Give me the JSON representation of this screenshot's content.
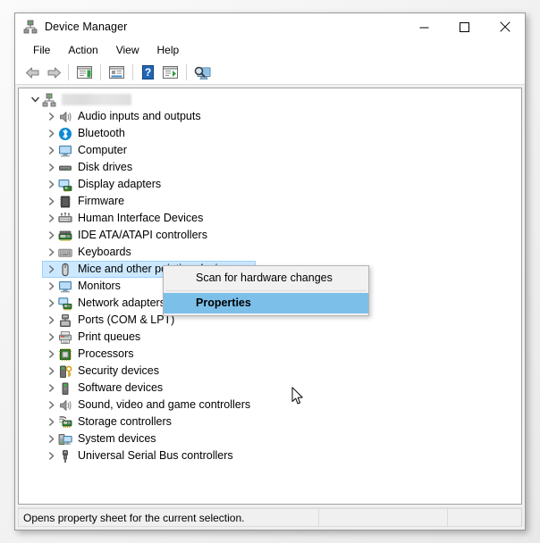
{
  "window": {
    "title": "Device Manager",
    "icon": "device-manager-icon",
    "controls": {
      "minimize": "—",
      "maximize": "□",
      "close": "✕"
    }
  },
  "menubar": {
    "items": [
      {
        "label": "File"
      },
      {
        "label": "Action"
      },
      {
        "label": "View"
      },
      {
        "label": "Help"
      }
    ]
  },
  "toolbar": {
    "buttons": [
      {
        "name": "back-arrow-icon",
        "tip": "Back"
      },
      {
        "name": "forward-arrow-icon",
        "tip": "Forward"
      },
      {
        "name": "show-hide-console-tree-icon",
        "tip": "Show/Hide Console Tree"
      },
      {
        "name": "properties-icon",
        "tip": "Properties"
      },
      {
        "name": "help-icon",
        "tip": "Help"
      },
      {
        "name": "update-driver-icon",
        "tip": "Update driver"
      },
      {
        "name": "scan-for-hardware-changes-icon",
        "tip": "Scan for hardware changes"
      }
    ]
  },
  "tree": {
    "root": {
      "label": "",
      "redacted": true,
      "icon": "computer-node-icon",
      "expanded": true
    },
    "items": [
      {
        "label": "Audio inputs and outputs",
        "icon": "speaker-icon"
      },
      {
        "label": "Bluetooth",
        "icon": "bluetooth-icon"
      },
      {
        "label": "Computer",
        "icon": "monitor-icon"
      },
      {
        "label": "Disk drives",
        "icon": "disk-drive-icon"
      },
      {
        "label": "Display adapters",
        "icon": "display-adapter-icon"
      },
      {
        "label": "Firmware",
        "icon": "firmware-chip-icon"
      },
      {
        "label": "Human Interface Devices",
        "icon": "hid-icon"
      },
      {
        "label": "IDE ATA/ATAPI controllers",
        "icon": "ide-controller-icon"
      },
      {
        "label": "Keyboards",
        "icon": "keyboard-icon"
      },
      {
        "label": "Mice and other pointing devices",
        "icon": "mouse-icon",
        "selected": true
      },
      {
        "label": "Monitors",
        "icon": "monitor-icon"
      },
      {
        "label": "Network adapters",
        "icon": "network-adapter-icon"
      },
      {
        "label": "Ports (COM & LPT)",
        "icon": "port-icon"
      },
      {
        "label": "Print queues",
        "icon": "printer-icon"
      },
      {
        "label": "Processors",
        "icon": "processor-icon"
      },
      {
        "label": "Security devices",
        "icon": "security-key-icon"
      },
      {
        "label": "Software devices",
        "icon": "software-device-icon"
      },
      {
        "label": "Sound, video and game controllers",
        "icon": "speaker-icon"
      },
      {
        "label": "Storage controllers",
        "icon": "storage-controller-icon"
      },
      {
        "label": "System devices",
        "icon": "system-device-icon"
      },
      {
        "label": "Universal Serial Bus controllers",
        "icon": "usb-icon"
      }
    ]
  },
  "context_menu": {
    "items": [
      {
        "label": "Scan for hardware changes",
        "highlighted": false
      },
      {
        "label": "Properties",
        "highlighted": true
      }
    ]
  },
  "statusbar": {
    "message": "Opens property sheet for the current selection.",
    "panel2": "",
    "panel3": ""
  },
  "colors": {
    "selection_fill": "#cce8ff",
    "selection_border": "#99d1ff",
    "menu_highlight": "#7cc0ea",
    "window_chrome": "#f0f0f0",
    "tree_background": "#ffffff"
  }
}
